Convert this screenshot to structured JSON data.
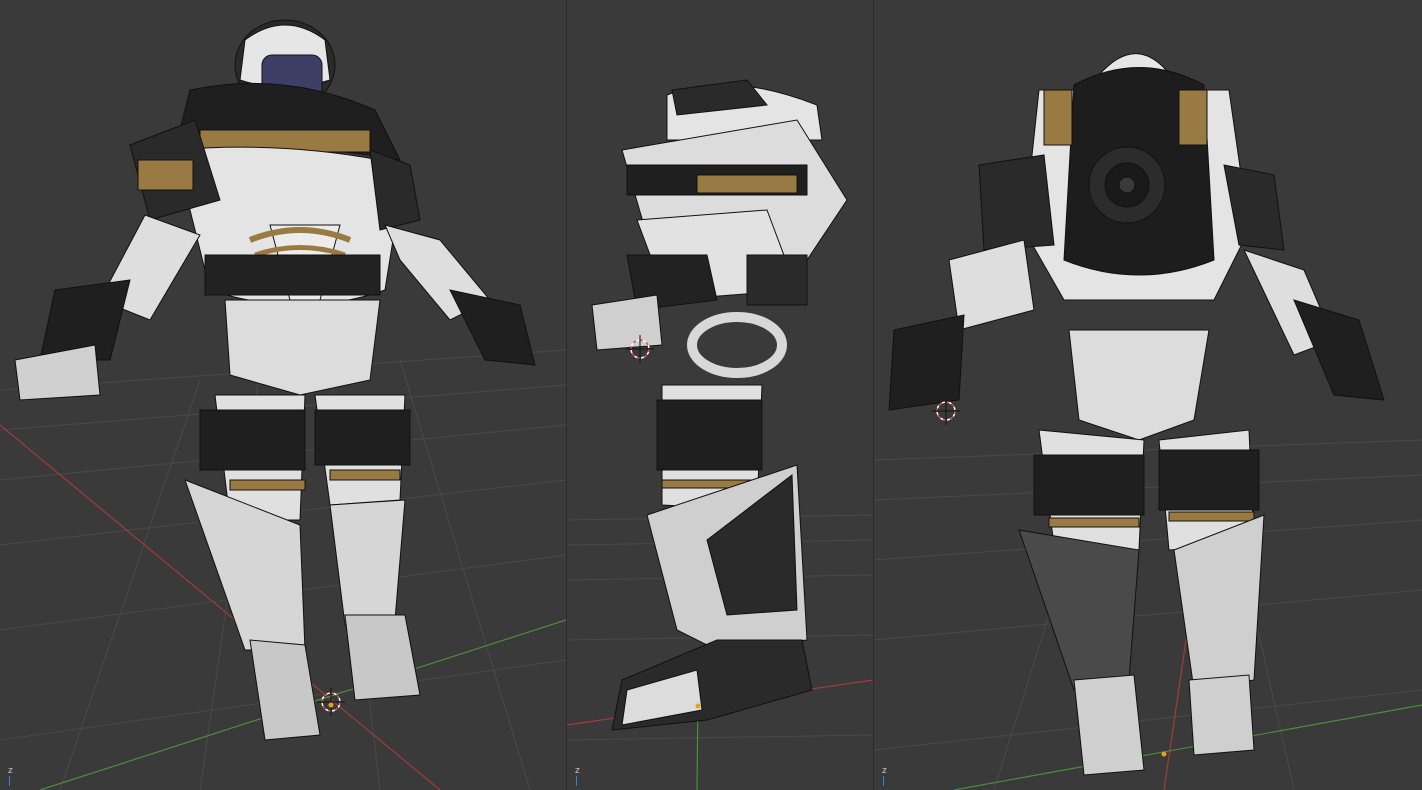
{
  "workspace": {
    "background": "#393939",
    "viewports": [
      {
        "name": "front",
        "axis_label": "z"
      },
      {
        "name": "side",
        "axis_label": "z"
      },
      {
        "name": "back",
        "axis_label": "z"
      }
    ]
  },
  "colors": {
    "grid": "#4a4a4a",
    "x_axis": "#a33b3b",
    "y_axis": "#4a8f3a",
    "armor_white": "#e8e8e8",
    "armor_dark": "#1d1d1d",
    "armor_gold": "#9a7a43",
    "visor": "#3d3f66",
    "cursor_red": "#e05050",
    "origin_dot": "#e8a020"
  },
  "icons": {
    "cursor": "3d-cursor-icon",
    "origin": "origin-point-icon",
    "axis": "axis-gizmo-icon"
  }
}
